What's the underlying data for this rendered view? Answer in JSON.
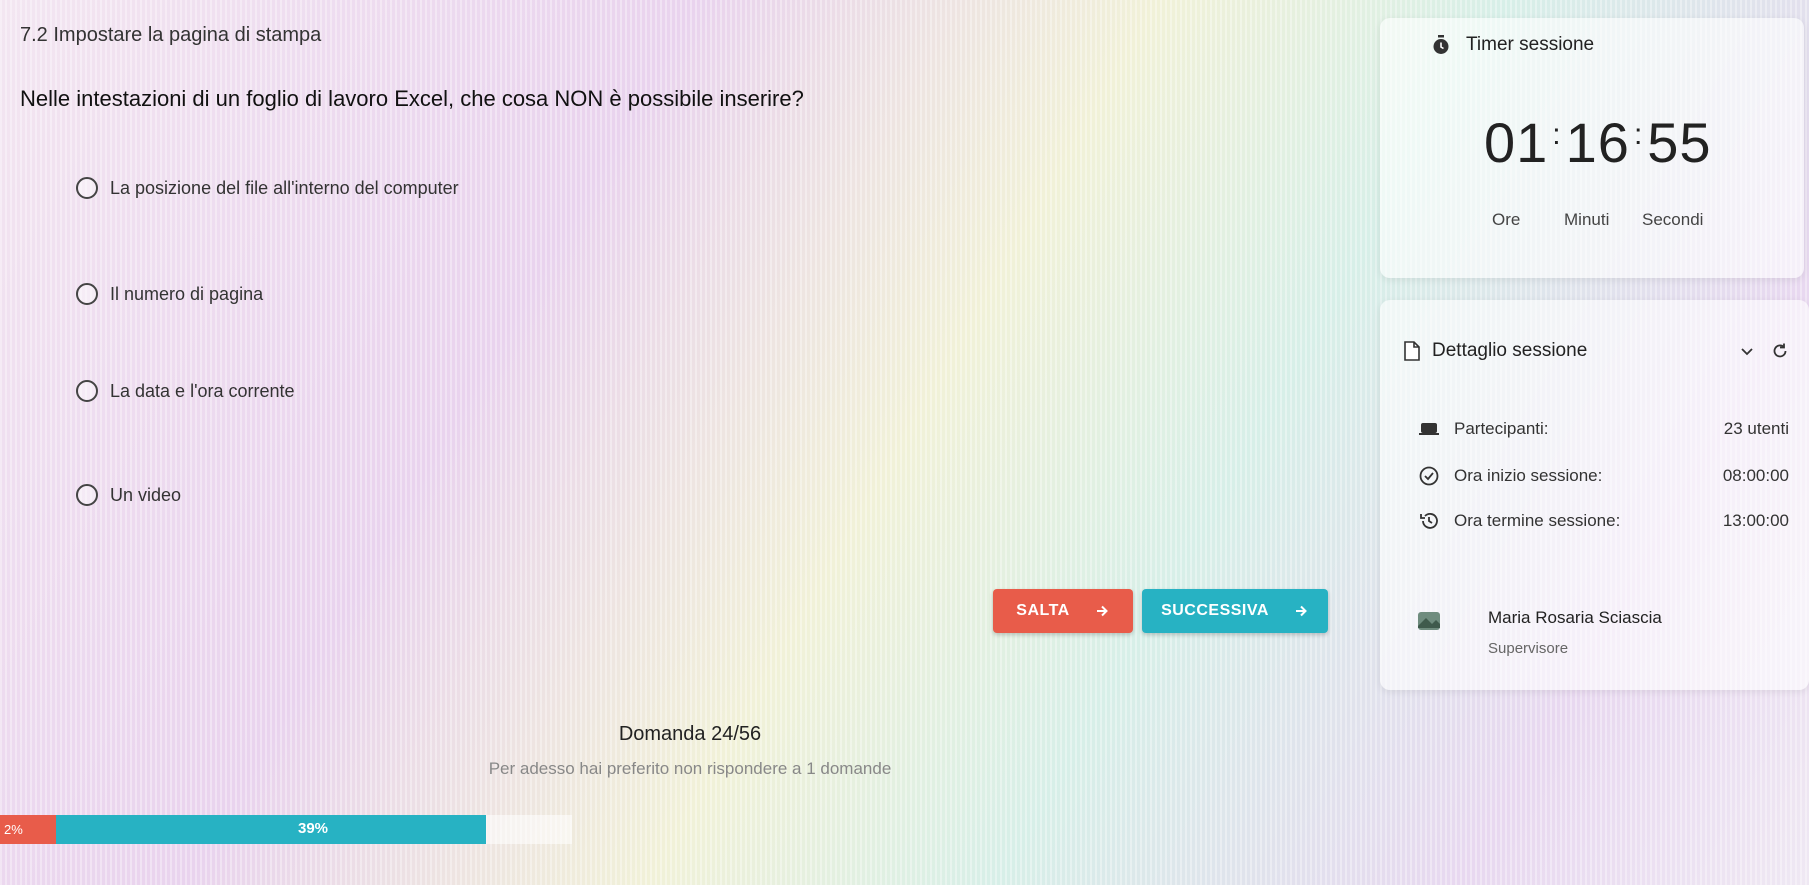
{
  "quiz": {
    "section_title": "7.2 Impostare la pagina di stampa",
    "question": "Nelle intestazioni di un foglio di lavoro Excel, che cosa NON è possibile inserire?",
    "options": [
      {
        "label": "La posizione del file all'interno del computer"
      },
      {
        "label": "Il numero di pagina"
      },
      {
        "label": "La data e l'ora corrente"
      },
      {
        "label": "Un video"
      }
    ],
    "skip_label": "SALTA",
    "next_label": "SUCCESSIVA",
    "counter": "Domanda 24/56",
    "hint": "Per adesso hai preferito non rispondere a 1 domande",
    "progress": {
      "min_label": "2%",
      "value_label": "39%",
      "value": 0.39
    }
  },
  "timer": {
    "title": "Timer sessione",
    "hours": "01",
    "minutes": "16",
    "seconds": "55",
    "hours_label": "Ore",
    "minutes_label": "Minuti",
    "seconds_label": "Secondi"
  },
  "session": {
    "title": "Dettaglio sessione",
    "participants_label": "Partecipanti:",
    "participants_value": "23 utenti",
    "start_label": "Ora inizio sessione:",
    "start_value": "08:00:00",
    "end_label": "Ora termine sessione:",
    "end_value": "13:00:00",
    "supervisor_name": "Maria Rosaria Sciascia",
    "supervisor_role": "Supervisore"
  },
  "colors": {
    "accent": "#27b2c3",
    "danger": "#e85c4a"
  },
  "icons": [
    "timer-icon",
    "document-icon",
    "chevron-down-icon",
    "refresh-icon",
    "participants-icon",
    "clock-check-icon",
    "history-icon",
    "avatar-icon",
    "arrow-right-icon"
  ]
}
